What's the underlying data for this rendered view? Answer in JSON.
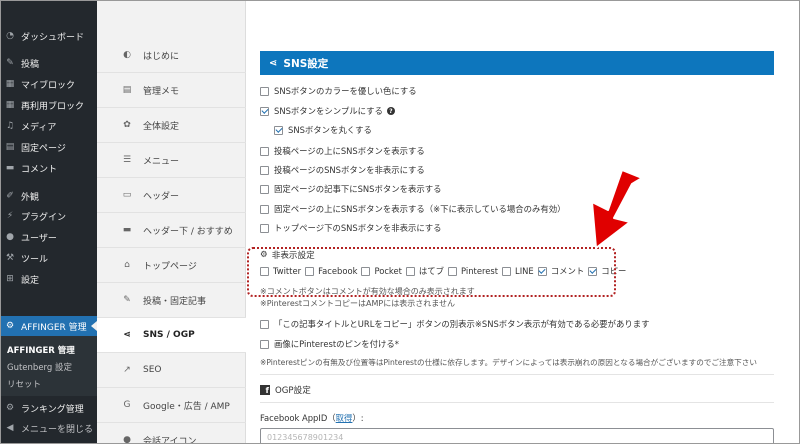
{
  "wp_menu": [
    {
      "label": "ダッシュボード",
      "icon": "dashboard-icon"
    },
    {
      "label": "投稿",
      "icon": "pin-icon"
    },
    {
      "label": "マイブロック",
      "icon": "blocks-icon"
    },
    {
      "label": "再利用ブロック",
      "icon": "blocks-icon"
    },
    {
      "label": "メディア",
      "icon": "media-icon"
    },
    {
      "label": "固定ページ",
      "icon": "page-icon"
    },
    {
      "label": "コメント",
      "icon": "comment-icon"
    },
    {
      "label": "外観",
      "icon": "brush-icon"
    },
    {
      "label": "プラグイン",
      "icon": "plugin-icon"
    },
    {
      "label": "ユーザー",
      "icon": "user-icon"
    },
    {
      "label": "ツール",
      "icon": "wrench-icon"
    },
    {
      "label": "設定",
      "icon": "settings-icon"
    },
    {
      "label": "AFFINGER 管理",
      "icon": "gear-icon"
    },
    {
      "label": "ランキング管理",
      "icon": "gear-icon"
    },
    {
      "label": "メニューを閉じる",
      "icon": "collapse-icon"
    }
  ],
  "wp_submenu": [
    "AFFINGER 管理",
    "Gutenberg 設定",
    "リセット"
  ],
  "theme_nav": [
    "はじめに",
    "管理メモ",
    "全体設定",
    "メニュー",
    "ヘッダー",
    "ヘッダー下 / おすすめ",
    "トップページ",
    "投稿・固定記事",
    "SNS / OGP",
    "SEO",
    "Google・広告 / AMP",
    "会話アイコン"
  ],
  "section_title": "SNS設定",
  "options": [
    {
      "label": "SNSボタンのカラーを優しい色にする",
      "checked": false
    },
    {
      "label": "SNSボタンをシンプルにする",
      "checked": true,
      "help": "?"
    },
    {
      "label": "SNSボタンを丸くする",
      "checked": true
    },
    {
      "label": "投稿ページの上にSNSボタンを表示する",
      "checked": false
    },
    {
      "label": "投稿ページのSNSボタンを非表示にする",
      "checked": false
    },
    {
      "label": "固定ページの記事下にSNSボタンを表示する",
      "checked": false
    },
    {
      "label": "固定ページの上にSNSボタンを表示する（※下に表示している場合のみ有効）",
      "checked": false
    },
    {
      "label": "トップページ下のSNSボタンを非表示にする",
      "checked": false
    }
  ],
  "hide_heading": "非表示設定",
  "hide_items": [
    {
      "label": "Twitter",
      "checked": false
    },
    {
      "label": "Facebook",
      "checked": false
    },
    {
      "label": "Pocket",
      "checked": false
    },
    {
      "label": "はてブ",
      "checked": false
    },
    {
      "label": "Pinterest",
      "checked": false
    },
    {
      "label": "LINE",
      "checked": true
    },
    {
      "label": "コメント",
      "checked": true
    },
    {
      "label": "コピー",
      "checked": false
    }
  ],
  "hide_note": "※コメントボタンはコメントが有効な場合のみ表示されます",
  "pinterest_note": "※PinterestコメントコピーはAMPには表示されません",
  "extra_options": [
    {
      "label": "「この記事タイトルとURLをコピー」ボタンの別表示※SNSボタン表示が有効である必要があります",
      "checked": false
    },
    {
      "label": "画像にPinterestのピンを付ける*",
      "checked": false
    }
  ],
  "pin_note": "※Pinterestピンの有無及び位置等はPinterestの仕様に依存します。デザインによっては表示崩れの原因となる場合がございますのでご注意下さい",
  "ogp_heading": "OGP設定",
  "ogp_field_label": "Facebook AppID（",
  "ogp_field_link": "取得",
  "ogp_field_label_end": "）:",
  "ogp_placeholder": "012345678901234",
  "colors": {
    "accent": "#0d76bd",
    "wp_active": "#2271b1",
    "annotation": "#e00000"
  }
}
